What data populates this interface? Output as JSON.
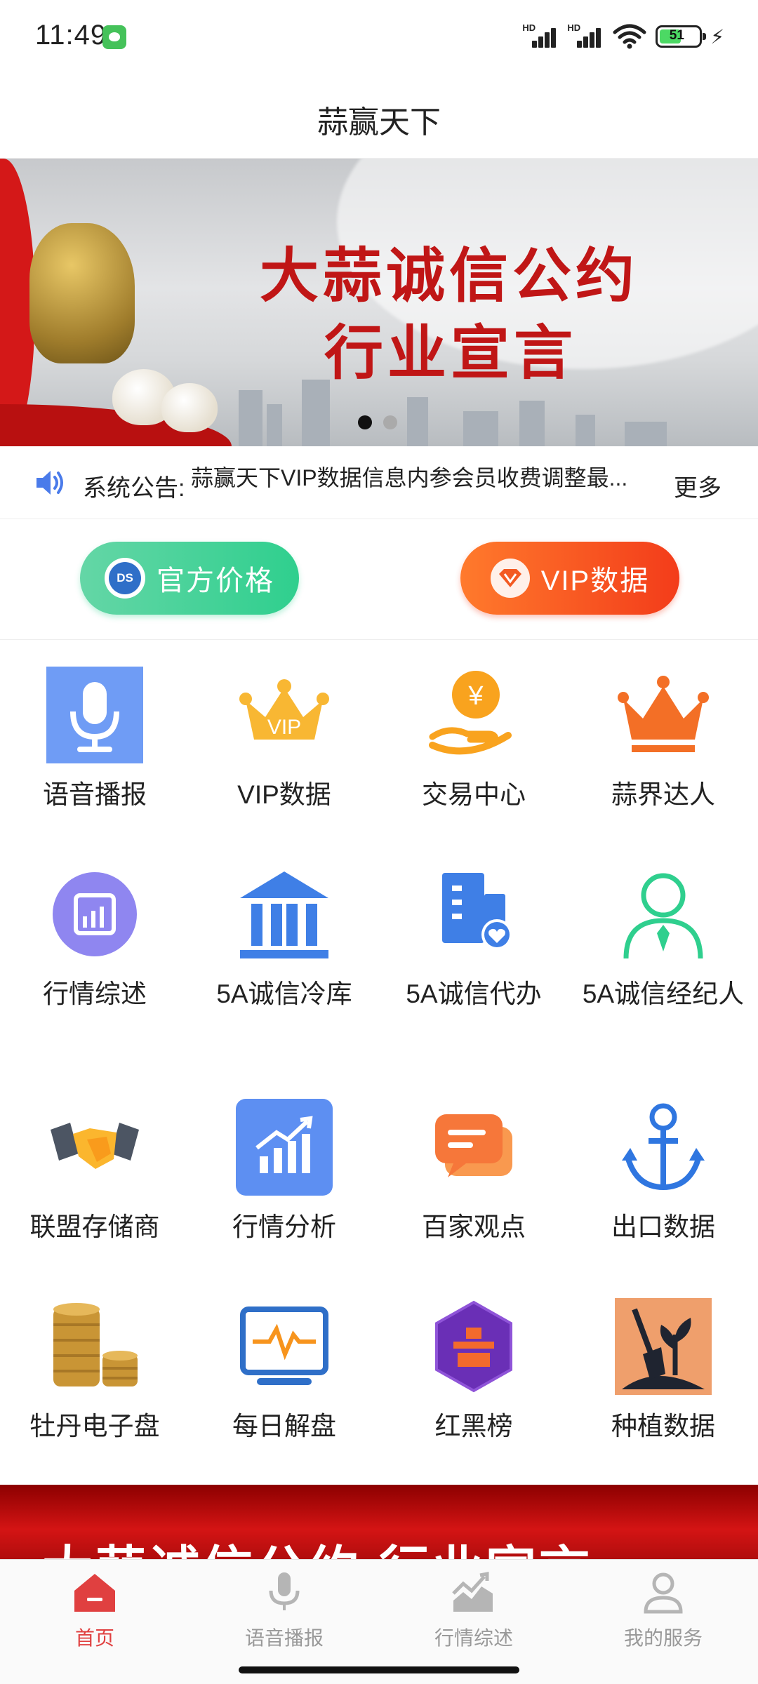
{
  "status_bar": {
    "time": "11:49",
    "battery": "51",
    "signal_label": "HD"
  },
  "header": {
    "title": "蒜赢天下"
  },
  "banner": {
    "line1": "大蒜诚信公约",
    "line2": "行业宣言",
    "slide_count": 2,
    "active_slide": 1
  },
  "notice": {
    "label": "系统公告:",
    "text": "蒜赢天下VIP数据信息内参会员收费调整最...",
    "more": "更多"
  },
  "quick_buttons": {
    "official_price": "官方价格",
    "official_price_badge": "DS",
    "vip_data": "VIP数据"
  },
  "grid": [
    {
      "label": "语音播报",
      "icon": "microphone-icon"
    },
    {
      "label": "VIP数据",
      "icon": "vip-crown-icon"
    },
    {
      "label": "交易中心",
      "icon": "yen-coin-hand-icon"
    },
    {
      "label": "蒜界达人",
      "icon": "crown-icon"
    },
    {
      "label": "行情综述",
      "icon": "chart-circle-icon"
    },
    {
      "label": "5A诚信冷库",
      "icon": "bank-building-icon"
    },
    {
      "label": "5A诚信代办",
      "icon": "building-heart-icon"
    },
    {
      "label": "5A诚信经纪人",
      "icon": "person-tie-icon"
    },
    {
      "label": "联盟存储商",
      "icon": "handshake-icon"
    },
    {
      "label": "行情分析",
      "icon": "growth-chart-icon"
    },
    {
      "label": "百家观点",
      "icon": "chat-bubbles-icon"
    },
    {
      "label": "出口数据",
      "icon": "anchor-icon"
    },
    {
      "label": "牡丹电子盘",
      "icon": "coin-stack-icon"
    },
    {
      "label": "每日解盘",
      "icon": "monitor-pulse-icon"
    },
    {
      "label": "红黑榜",
      "icon": "hexagon-podium-icon"
    },
    {
      "label": "种植数据",
      "icon": "plant-shovel-icon"
    }
  ],
  "grid_icon_vip_text": "VIP",
  "grid_icon_yen": "¥",
  "promo": {
    "text": "大蒜诚信公约    行业宣言"
  },
  "tabbar": [
    {
      "label": "首页",
      "icon": "home-icon",
      "active": true
    },
    {
      "label": "语音播报",
      "icon": "microphone-icon",
      "active": false
    },
    {
      "label": "行情综述",
      "icon": "trend-chart-icon",
      "active": false
    },
    {
      "label": "我的服务",
      "icon": "user-icon",
      "active": false
    }
  ],
  "colors": {
    "accent_red": "#e04040",
    "green_pill": "#2fcf8e",
    "orange_pill": "#f33c1a",
    "banner_text": "#c01616",
    "tab_inactive": "#999999"
  }
}
